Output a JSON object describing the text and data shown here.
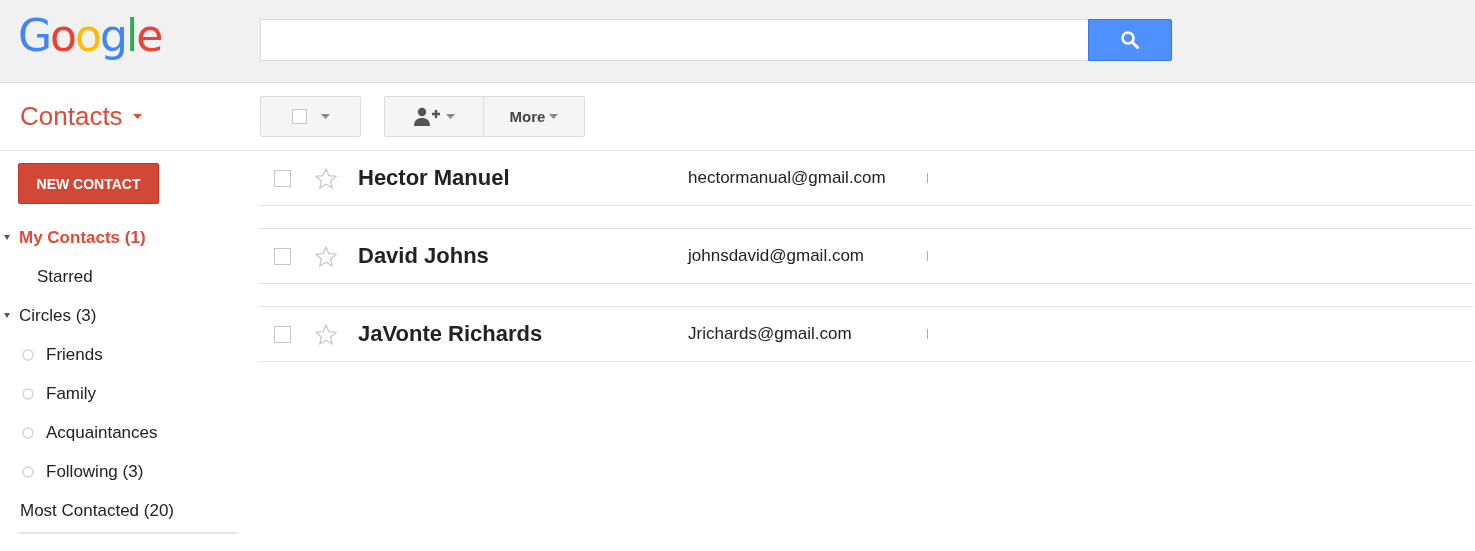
{
  "logo": "Google",
  "app_menu": {
    "label": "Contacts"
  },
  "toolbar": {
    "select_all_checked": false,
    "more_label": "More"
  },
  "sidebar": {
    "new_button": "NEW CONTACT",
    "items": [
      {
        "label": "My Contacts (1)",
        "selected": true,
        "expanded": true,
        "children": [
          {
            "label": "Starred",
            "kind": "plain",
            "selected": false
          }
        ]
      },
      {
        "label": "Circles (3)",
        "selected": false,
        "expanded": true,
        "children": [
          {
            "label": "Friends",
            "kind": "circle",
            "selected": false
          },
          {
            "label": "Family",
            "kind": "circle",
            "selected": false
          },
          {
            "label": "Acquaintances",
            "kind": "circle",
            "selected": false
          },
          {
            "label": "Following (3)",
            "kind": "circle",
            "selected": false
          }
        ]
      },
      {
        "label": "Most Contacted (20)",
        "selected": false
      }
    ]
  },
  "contacts": [
    {
      "name": "Hector Manuel",
      "email": "hectormanual@gmail.com",
      "checked": false,
      "starred": false
    },
    {
      "name": "David Johns",
      "email": "johnsdavid@gmail.com",
      "checked": false,
      "starred": false
    },
    {
      "name": "JaVonte Richards",
      "email": "Jrichards@gmail.com",
      "checked": false,
      "starred": false
    }
  ]
}
